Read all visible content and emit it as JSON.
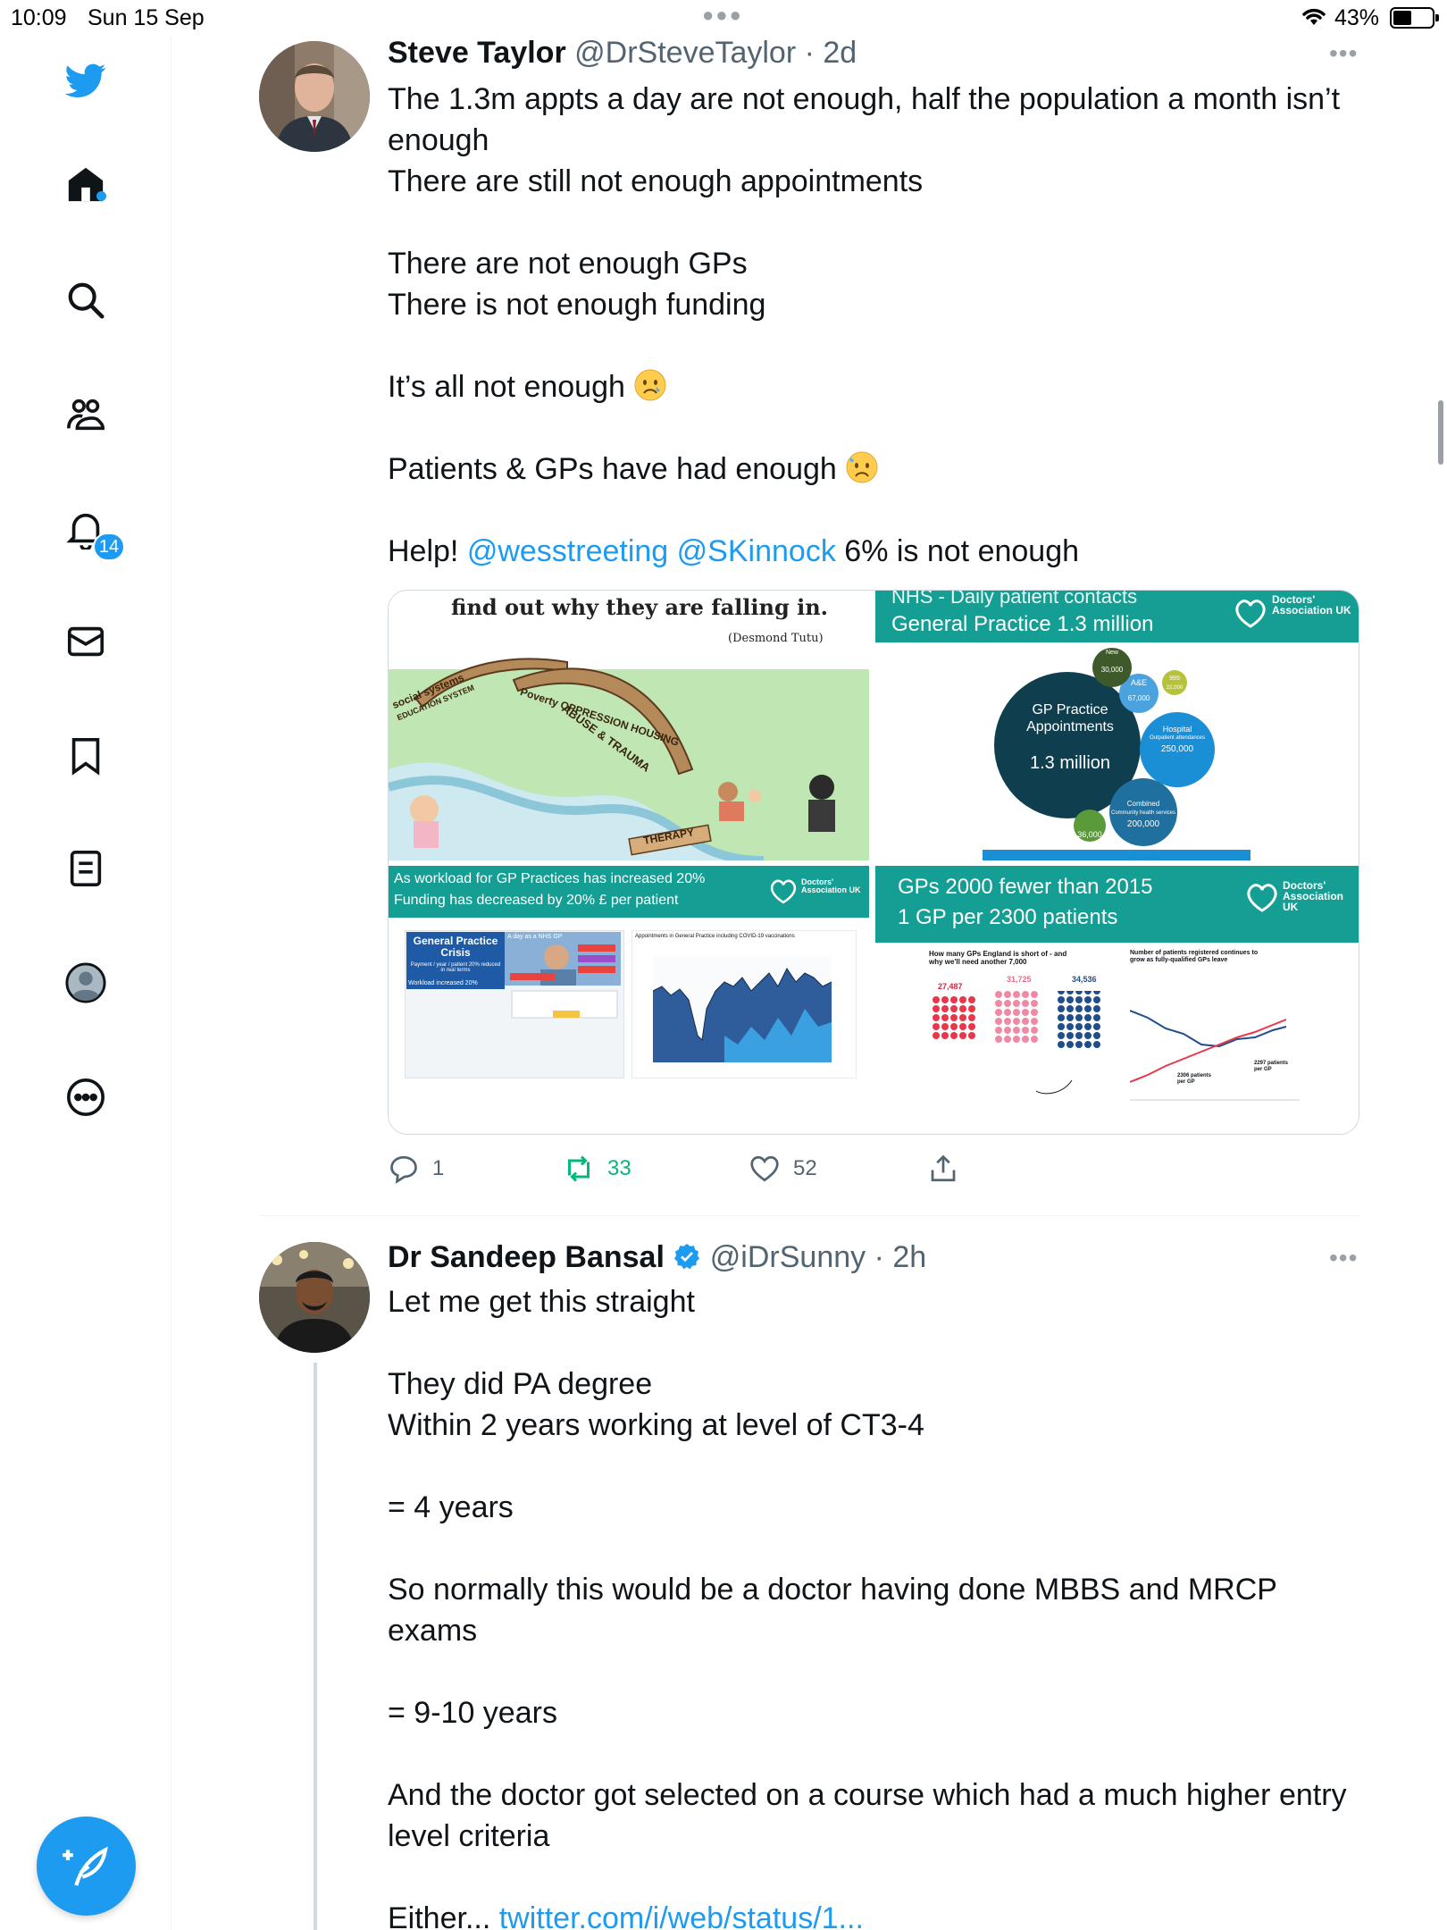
{
  "status_bar": {
    "time": "10:09",
    "date": "Sun 15 Sep",
    "battery": "43%"
  },
  "sidebar": {
    "notification_count": "14",
    "items": [
      "home-icon",
      "search-icon",
      "communities-icon",
      "notifications-icon",
      "messages-icon",
      "bookmarks-icon",
      "lists-icon",
      "profile-icon",
      "more-icon"
    ]
  },
  "colors": {
    "accent": "#1d9bf0",
    "retweet_green": "#00ba7c",
    "text_primary": "#0f1419",
    "text_secondary": "#536471"
  },
  "tweet1": {
    "name": "Steve Taylor",
    "handle": "@DrSteveTaylor",
    "time": "· 2d",
    "lines": [
      "The 1.3m appts a day are not enough, half the population a month isn’t enough",
      "There are still not enough appointments",
      "",
      "There are not enough GPs",
      "There is not enough funding",
      "",
      "It’s all not enough",
      "",
      "Patients & GPs have had enough",
      ""
    ],
    "help_prefix": "Help!",
    "mention1": "@wesstreeting",
    "mention2": "@SKinnock",
    "help_suffix": "6% is not enough",
    "media": {
      "cartoon_quote": "find out why they are falling in.",
      "cartoon_author": "(Desmond Tutu)",
      "cartoon_bridge_left": "social systems",
      "cartoon_bridge_left2": "EDUCATION SYSTEM",
      "cartoon_bridge_right": "Poverty OPPRESSION HOUSING",
      "cartoon_bridge_right2": "ABUSE & TRAUMA",
      "cartoon_plank": "THERAPY",
      "nhs_title": "NHS - Daily patient contacts",
      "nhs_subtitle": "General Practice 1.3 million",
      "org_name": "Doctors' Association UK",
      "bubble_main_label": "GP Practice Appointments",
      "bubble_main_value": "1.3 million",
      "bubble_hospital_label": "Hospital",
      "bubble_hospital_sub": "Outpatient attendances",
      "bubble_hospital_value": "250,000",
      "bubble_community_label": "Combined",
      "bubble_community_sub": "Community health services",
      "bubble_community_value": "200,000",
      "bubble_ae_label": "A&E",
      "bubble_ae_value": "67,000",
      "bubble_new_label": "New",
      "bubble_new_value": "30,000",
      "bubble_999_label": "999",
      "bubble_999_value": "22,000",
      "bubble_small_value": "36,000",
      "workload_line1": "As workload for GP Practices has increased 20%",
      "workload_line2": "Funding has decreased by 20% £ per patient",
      "crisis_title": "General Practice Crisis",
      "crisis_sub": "Payment / year / patient 20% reduced in real terms",
      "crisis_sub2": "Workload increased 20%",
      "nhs_gp_day": "A day as a NHS GP",
      "appt_chart_title": "Appointments in General Practice including COVID-19 vaccinations",
      "gp_fewer_line1": "GPs 2000 fewer than 2015",
      "gp_fewer_line2": "1 GP per 2300 patients",
      "gp_short_title": "How many GPs England is short of - and why we'll need another 7,000",
      "gp_short_v1": "27,487",
      "gp_short_v2": "31,725",
      "gp_short_v3": "34,536",
      "patients_title": "Number of patients registered continues to grow as fully-qualified GPs leave",
      "patients_label1": "2306 patients per GP",
      "patients_label2": "2297 patients per GP"
    },
    "replies": "1",
    "retweets": "33",
    "likes": "52"
  },
  "tweet2": {
    "name": "Dr Sandeep Bansal",
    "handle": "@iDrSunny",
    "time": "· 2h",
    "lines": [
      "Let me get this straight",
      "",
      "They did PA degree",
      "Within 2 years working at level of CT3-4",
      "",
      "= 4 years",
      "",
      "So normally this would be a doctor having done MBBS and MRCP exams",
      "",
      "= 9-10 years",
      "",
      "And the doctor got selected on a course which had a much higher entry level criteria",
      ""
    ],
    "either_prefix": "Either...",
    "link": "twitter.com/i/web/status/1..."
  }
}
